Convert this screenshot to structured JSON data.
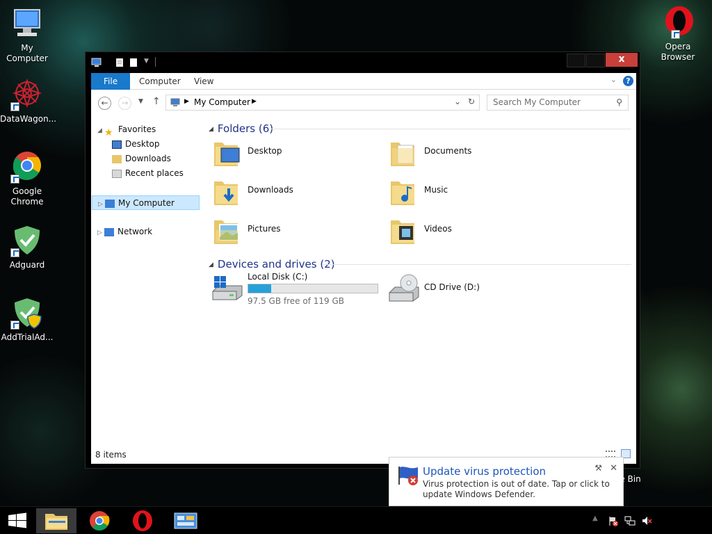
{
  "desktop": {
    "icons": [
      {
        "label": "My Computer"
      },
      {
        "label": "DataWagon..."
      },
      {
        "label": "Google Chrome"
      },
      {
        "label": "Adguard"
      },
      {
        "label": "AddTrialAd..."
      },
      {
        "label": "Opera Browser"
      },
      {
        "label": "le Bin"
      }
    ]
  },
  "window": {
    "ribbon": {
      "tabs": [
        "File",
        "Computer",
        "View"
      ],
      "help": "?"
    },
    "close_glyph": "x",
    "address": {
      "path": "My Computer"
    },
    "search": {
      "placeholder": "Search My Computer"
    },
    "nav": {
      "favorites": "Favorites",
      "desktop": "Desktop",
      "downloads": "Downloads",
      "recent": "Recent places",
      "my_computer": "My Computer",
      "network": "Network"
    },
    "folders_header": "Folders (6)",
    "folders": [
      "Desktop",
      "Documents",
      "Downloads",
      "Music",
      "Pictures",
      "Videos"
    ],
    "drives_header": "Devices and drives (2)",
    "drives": {
      "local": {
        "name": "Local Disk (C:)",
        "free": "97.5 GB free of 119 GB",
        "used_fraction": 0.18
      },
      "cd": {
        "name": "CD Drive (D:)"
      }
    },
    "status": "8 items"
  },
  "notification": {
    "title": "Update virus protection",
    "message": "Virus protection is out of date. Tap or click to update Windows Defender."
  },
  "colors": {
    "accent": "#1979ca",
    "close": "#c7403a",
    "header_text": "#1e3287",
    "drive_fill": "#26a0da"
  }
}
